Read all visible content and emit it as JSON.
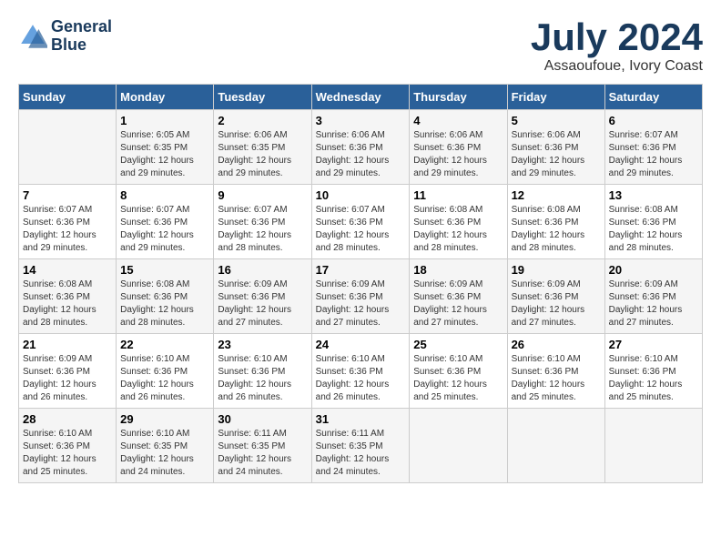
{
  "header": {
    "logo_line1": "General",
    "logo_line2": "Blue",
    "month": "July 2024",
    "location": "Assaoufoue, Ivory Coast"
  },
  "days_of_week": [
    "Sunday",
    "Monday",
    "Tuesday",
    "Wednesday",
    "Thursday",
    "Friday",
    "Saturday"
  ],
  "weeks": [
    [
      {
        "num": "",
        "detail": ""
      },
      {
        "num": "1",
        "detail": "Sunrise: 6:05 AM\nSunset: 6:35 PM\nDaylight: 12 hours\nand 29 minutes."
      },
      {
        "num": "2",
        "detail": "Sunrise: 6:06 AM\nSunset: 6:35 PM\nDaylight: 12 hours\nand 29 minutes."
      },
      {
        "num": "3",
        "detail": "Sunrise: 6:06 AM\nSunset: 6:36 PM\nDaylight: 12 hours\nand 29 minutes."
      },
      {
        "num": "4",
        "detail": "Sunrise: 6:06 AM\nSunset: 6:36 PM\nDaylight: 12 hours\nand 29 minutes."
      },
      {
        "num": "5",
        "detail": "Sunrise: 6:06 AM\nSunset: 6:36 PM\nDaylight: 12 hours\nand 29 minutes."
      },
      {
        "num": "6",
        "detail": "Sunrise: 6:07 AM\nSunset: 6:36 PM\nDaylight: 12 hours\nand 29 minutes."
      }
    ],
    [
      {
        "num": "7",
        "detail": "Sunrise: 6:07 AM\nSunset: 6:36 PM\nDaylight: 12 hours\nand 29 minutes."
      },
      {
        "num": "8",
        "detail": "Sunrise: 6:07 AM\nSunset: 6:36 PM\nDaylight: 12 hours\nand 29 minutes."
      },
      {
        "num": "9",
        "detail": "Sunrise: 6:07 AM\nSunset: 6:36 PM\nDaylight: 12 hours\nand 28 minutes."
      },
      {
        "num": "10",
        "detail": "Sunrise: 6:07 AM\nSunset: 6:36 PM\nDaylight: 12 hours\nand 28 minutes."
      },
      {
        "num": "11",
        "detail": "Sunrise: 6:08 AM\nSunset: 6:36 PM\nDaylight: 12 hours\nand 28 minutes."
      },
      {
        "num": "12",
        "detail": "Sunrise: 6:08 AM\nSunset: 6:36 PM\nDaylight: 12 hours\nand 28 minutes."
      },
      {
        "num": "13",
        "detail": "Sunrise: 6:08 AM\nSunset: 6:36 PM\nDaylight: 12 hours\nand 28 minutes."
      }
    ],
    [
      {
        "num": "14",
        "detail": "Sunrise: 6:08 AM\nSunset: 6:36 PM\nDaylight: 12 hours\nand 28 minutes."
      },
      {
        "num": "15",
        "detail": "Sunrise: 6:08 AM\nSunset: 6:36 PM\nDaylight: 12 hours\nand 28 minutes."
      },
      {
        "num": "16",
        "detail": "Sunrise: 6:09 AM\nSunset: 6:36 PM\nDaylight: 12 hours\nand 27 minutes."
      },
      {
        "num": "17",
        "detail": "Sunrise: 6:09 AM\nSunset: 6:36 PM\nDaylight: 12 hours\nand 27 minutes."
      },
      {
        "num": "18",
        "detail": "Sunrise: 6:09 AM\nSunset: 6:36 PM\nDaylight: 12 hours\nand 27 minutes."
      },
      {
        "num": "19",
        "detail": "Sunrise: 6:09 AM\nSunset: 6:36 PM\nDaylight: 12 hours\nand 27 minutes."
      },
      {
        "num": "20",
        "detail": "Sunrise: 6:09 AM\nSunset: 6:36 PM\nDaylight: 12 hours\nand 27 minutes."
      }
    ],
    [
      {
        "num": "21",
        "detail": "Sunrise: 6:09 AM\nSunset: 6:36 PM\nDaylight: 12 hours\nand 26 minutes."
      },
      {
        "num": "22",
        "detail": "Sunrise: 6:10 AM\nSunset: 6:36 PM\nDaylight: 12 hours\nand 26 minutes."
      },
      {
        "num": "23",
        "detail": "Sunrise: 6:10 AM\nSunset: 6:36 PM\nDaylight: 12 hours\nand 26 minutes."
      },
      {
        "num": "24",
        "detail": "Sunrise: 6:10 AM\nSunset: 6:36 PM\nDaylight: 12 hours\nand 26 minutes."
      },
      {
        "num": "25",
        "detail": "Sunrise: 6:10 AM\nSunset: 6:36 PM\nDaylight: 12 hours\nand 25 minutes."
      },
      {
        "num": "26",
        "detail": "Sunrise: 6:10 AM\nSunset: 6:36 PM\nDaylight: 12 hours\nand 25 minutes."
      },
      {
        "num": "27",
        "detail": "Sunrise: 6:10 AM\nSunset: 6:36 PM\nDaylight: 12 hours\nand 25 minutes."
      }
    ],
    [
      {
        "num": "28",
        "detail": "Sunrise: 6:10 AM\nSunset: 6:36 PM\nDaylight: 12 hours\nand 25 minutes."
      },
      {
        "num": "29",
        "detail": "Sunrise: 6:10 AM\nSunset: 6:35 PM\nDaylight: 12 hours\nand 24 minutes."
      },
      {
        "num": "30",
        "detail": "Sunrise: 6:11 AM\nSunset: 6:35 PM\nDaylight: 12 hours\nand 24 minutes."
      },
      {
        "num": "31",
        "detail": "Sunrise: 6:11 AM\nSunset: 6:35 PM\nDaylight: 12 hours\nand 24 minutes."
      },
      {
        "num": "",
        "detail": ""
      },
      {
        "num": "",
        "detail": ""
      },
      {
        "num": "",
        "detail": ""
      }
    ]
  ]
}
